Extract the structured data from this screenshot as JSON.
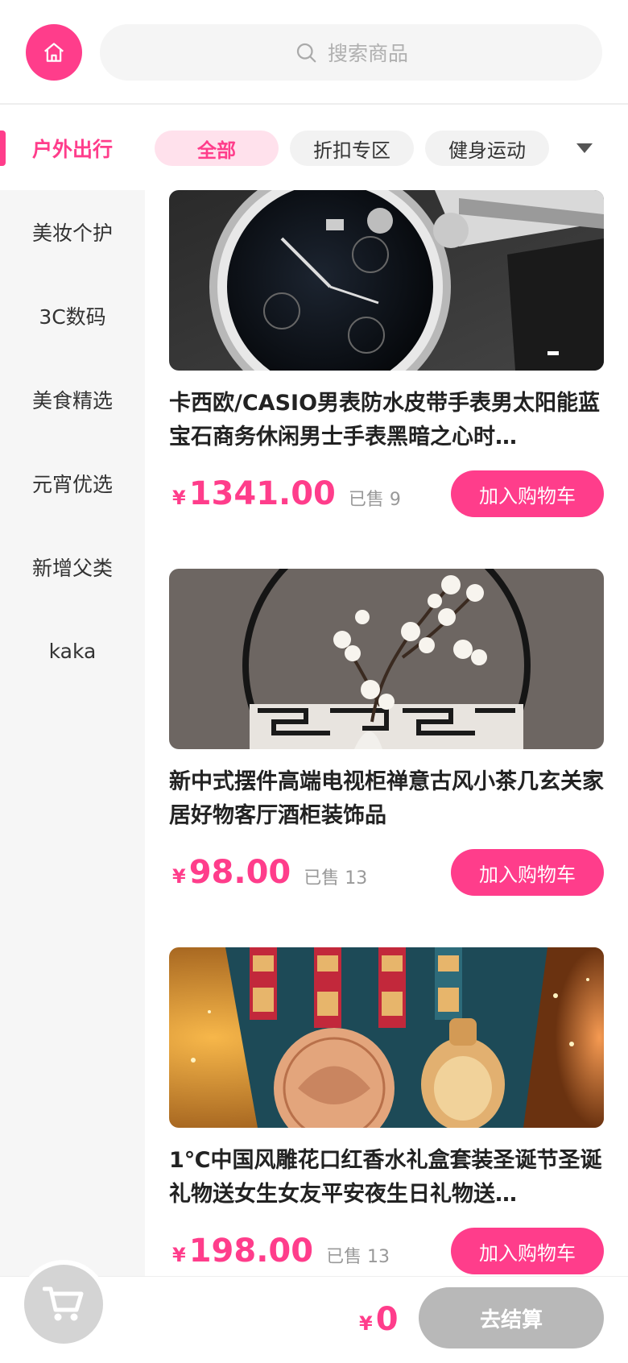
{
  "header": {
    "home_icon": "home-icon",
    "search_icon": "search-icon",
    "search_placeholder": "搜索商品"
  },
  "sidebar": {
    "items": [
      {
        "label": "户外出行",
        "active": true
      },
      {
        "label": "美妆个护"
      },
      {
        "label": "3C数码"
      },
      {
        "label": "美食精选"
      },
      {
        "label": "元宵优选"
      },
      {
        "label": "新增父类"
      },
      {
        "label": "kaka"
      }
    ]
  },
  "tabs": {
    "items": [
      {
        "label": "全部",
        "active": true
      },
      {
        "label": "折扣专区"
      },
      {
        "label": "健身运动"
      }
    ],
    "expand_icon": "caret-down-icon"
  },
  "products": [
    {
      "title": "卡西欧/CASIO男表防水皮带手表男太阳能蓝宝石商务休闲男士手表黑暗之心时…",
      "currency": "¥",
      "price": "1341.00",
      "sold": "已售 9",
      "button": "加入购物车",
      "image": "watch-photo"
    },
    {
      "title": "新中式摆件高端电视柜禅意古风小茶几玄关家居好物客厅酒柜装饰品",
      "currency": "¥",
      "price": "98.00",
      "sold": "已售 13",
      "button": "加入购物车",
      "image": "plum-blossom-decor-photo"
    },
    {
      "title": "1℃中国风雕花口红香水礼盒套装圣诞节圣诞礼物送女生女友平安夜生日礼物送…",
      "currency": "¥",
      "price": "198.00",
      "sold": "已售 13",
      "button": "加入购物车",
      "image": "lipstick-gift-box-photo"
    }
  ],
  "footer": {
    "cart_icon": "cart-icon",
    "currency": "¥",
    "total": "0",
    "checkout": "去结算"
  },
  "colors": {
    "accent": "#ff3d8b",
    "accent_light": "#ffe1ec",
    "sidebar_bg": "#f6f6f6",
    "disabled": "#b8b8b8"
  }
}
